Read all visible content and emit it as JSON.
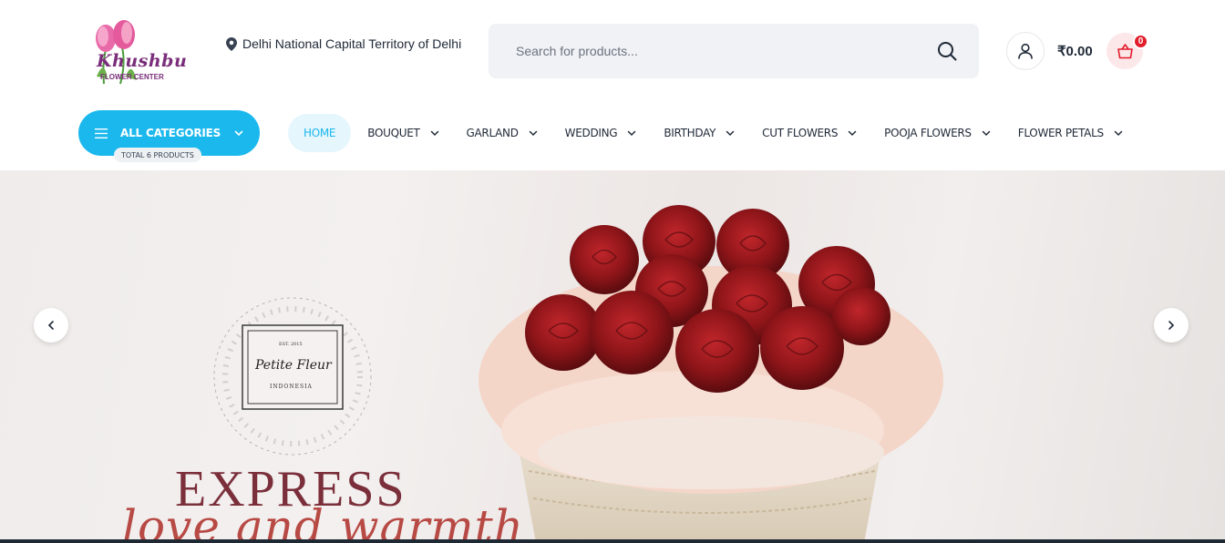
{
  "brand": {
    "logo_name": "Khushbu",
    "logo_tagline": "FLOWER CENTER"
  },
  "location": {
    "text": "Delhi National Capital Territory of Delhi"
  },
  "search": {
    "placeholder": "Search for products..."
  },
  "cart": {
    "total": "₹0.00",
    "count": "0"
  },
  "categories": {
    "label": "ALL CATEGORIES",
    "count_label": "TOTAL 6 PRODUCTS"
  },
  "nav": {
    "items": [
      {
        "label": "HOME",
        "active": true
      },
      {
        "label": "BOUQUET"
      },
      {
        "label": "GARLAND"
      },
      {
        "label": "WEDDING"
      },
      {
        "label": "BIRTHDAY"
      },
      {
        "label": "CUT FLOWERS"
      },
      {
        "label": "POOJA FLOWERS"
      },
      {
        "label": "FLOWER PETALS"
      }
    ]
  },
  "hero": {
    "badge_est": "EST. 2015",
    "badge_name": "Petite Fleur",
    "badge_country": "INDONESIA",
    "title": "EXPRESS",
    "subtitle": "love and warmth"
  },
  "colors": {
    "accent": "#1bb8ed",
    "badge": "#e11d2a",
    "hero_title": "#7b2f3b"
  }
}
